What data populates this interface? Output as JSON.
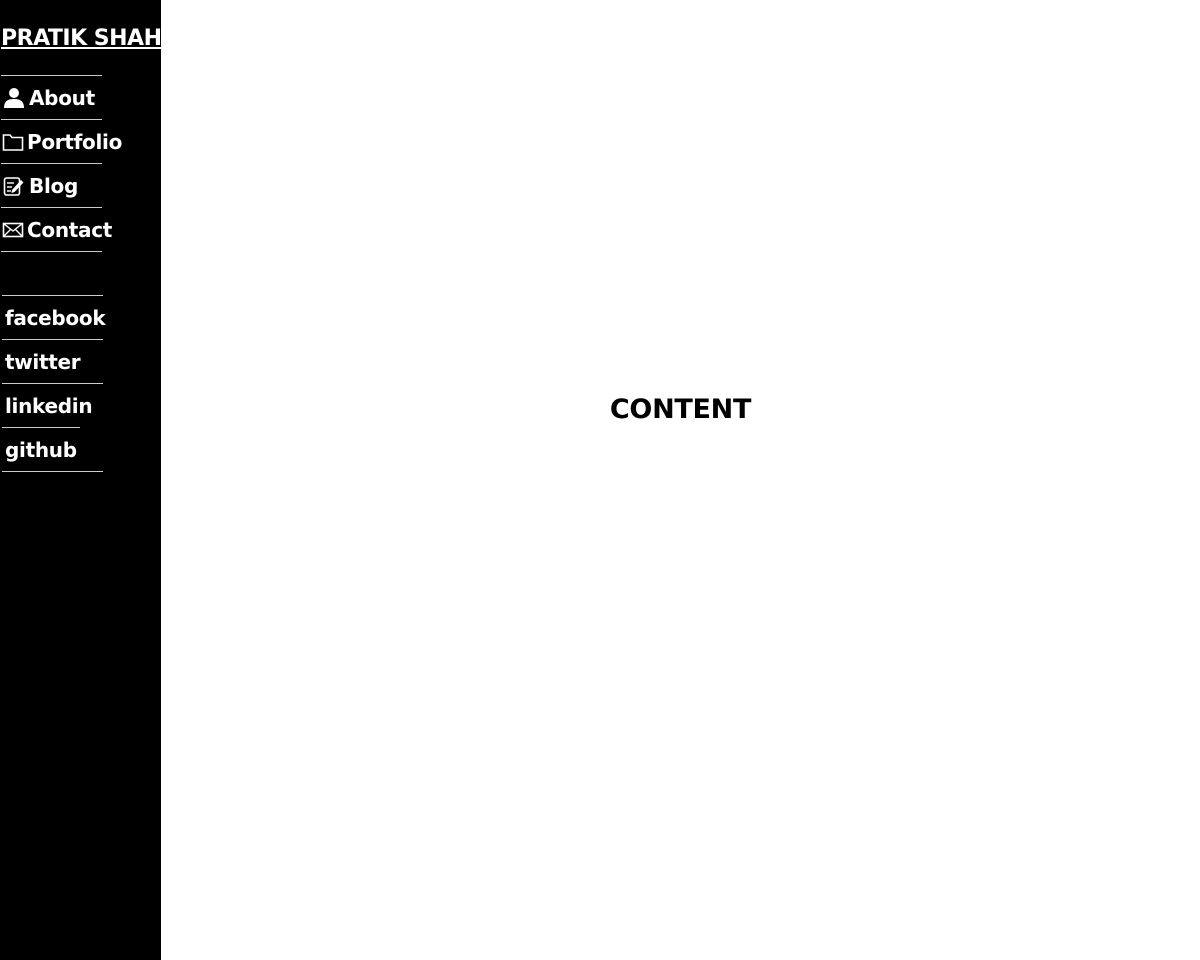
{
  "site": {
    "title": "PRATIK SHAH"
  },
  "nav": {
    "items": [
      {
        "label": "About",
        "icon": "user-icon"
      },
      {
        "label": "Portfolio",
        "icon": "folder-icon"
      },
      {
        "label": "Blog",
        "icon": "edit-icon"
      },
      {
        "label": "Contact",
        "icon": "mail-icon"
      }
    ]
  },
  "social": {
    "items": [
      {
        "label": "facebook"
      },
      {
        "label": "twitter"
      },
      {
        "label": "linkedin"
      },
      {
        "label": "github"
      }
    ]
  },
  "main": {
    "content_label": "CONTENT"
  },
  "colors": {
    "sidebar_bg": "#000000",
    "sidebar_text": "#ffffff",
    "divider": "#cccccc",
    "main_bg": "#ffffff",
    "main_text": "#000000"
  }
}
